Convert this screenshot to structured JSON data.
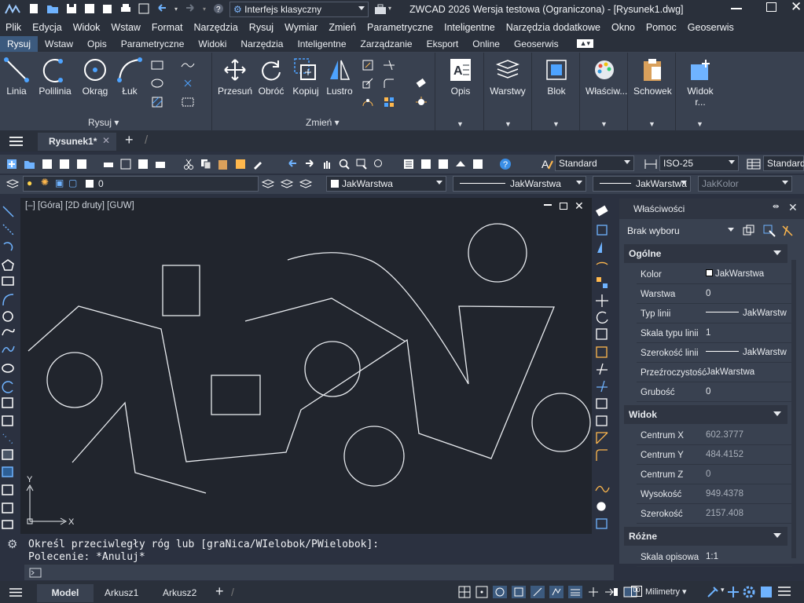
{
  "window": {
    "workspace": "Interfejs klasyczny",
    "title": "ZWCAD 2026 Wersja testowa (Ograniczona) - [Rysunek1.dwg]"
  },
  "menu": [
    "Plik",
    "Edycja",
    "Widok",
    "Wstaw",
    "Format",
    "Narzędzia",
    "Rysuj",
    "Wymiar",
    "Zmień",
    "Parametryczne",
    "Inteligentne",
    "Narzędzia dodatkowe",
    "Okno",
    "Pomoc",
    "Geoserwis"
  ],
  "ribbon_tabs": [
    "Rysuj",
    "Wstaw",
    "Opis",
    "Parametryczne",
    "Widoki",
    "Narzędzia",
    "Inteligentne",
    "Zarządzanie",
    "Eksport",
    "Online",
    "Geoserwis"
  ],
  "ribbon": {
    "draw": {
      "linia": "Linia",
      "polilinia": "Polilinia",
      "okrag": "Okrąg",
      "luk": "Łuk",
      "panel": "Rysuj"
    },
    "modify": {
      "przesun": "Przesuń",
      "obroc": "Obróć",
      "kopiuj": "Kopiuj",
      "lustro": "Lustro",
      "panel": "Zmień"
    },
    "opis": "Opis",
    "warstwy": "Warstwy",
    "blok": "Blok",
    "wlasciwosci": "Właściw...",
    "schowek": "Schowek",
    "widok": "Widok r..."
  },
  "doc_tab": "Rysunek1*",
  "toolbar": {
    "text_style": "Standard",
    "dim_style": "ISO-25",
    "table_style": "Standard",
    "layer": "0",
    "color": "JakWarstwa",
    "linetype": "JakWarstwa",
    "lineweight": "JakWarstwa",
    "plotstyle": "JakKolor"
  },
  "viewport_label": "[–] [Góra] [2D druty] [GUW]",
  "ucs": {
    "x": "X",
    "y": "Y"
  },
  "properties": {
    "title": "Właściwości",
    "selection": "Brak wyboru",
    "general_header": "Ogólne",
    "general": [
      {
        "k": "Kolor",
        "v": "JakWarstwa"
      },
      {
        "k": "Warstwa",
        "v": "0"
      },
      {
        "k": "Typ linii",
        "v": "JakWarstw"
      },
      {
        "k": "Skala typu linii",
        "v": "1"
      },
      {
        "k": "Szerokość linii",
        "v": "JakWarstw"
      },
      {
        "k": "Przeźroczystość",
        "v": "JakWarstwa"
      },
      {
        "k": "Grubość",
        "v": "0"
      }
    ],
    "view_header": "Widok",
    "view": [
      {
        "k": "Centrum X",
        "v": "602.3777"
      },
      {
        "k": "Centrum Y",
        "v": "484.4152"
      },
      {
        "k": "Centrum Z",
        "v": "0"
      },
      {
        "k": "Wysokość",
        "v": "949.4378"
      },
      {
        "k": "Szerokość",
        "v": "2157.408"
      }
    ],
    "misc_header": "Różne",
    "misc": [
      {
        "k": "Skala opisowa",
        "v": "1:1"
      }
    ]
  },
  "command": {
    "line1": "Określ przeciwległy róg lub [graNica/WIelobok/PWielobok]:",
    "line2": "Polecenie: *Anuluj*"
  },
  "status": {
    "tabs": [
      "Model",
      "Arkusz1",
      "Arkusz2"
    ],
    "units": "Milimetry"
  },
  "colors": {
    "accent": "#3c5a7e",
    "canvas": "#21252d",
    "toolbar": "#394150"
  }
}
